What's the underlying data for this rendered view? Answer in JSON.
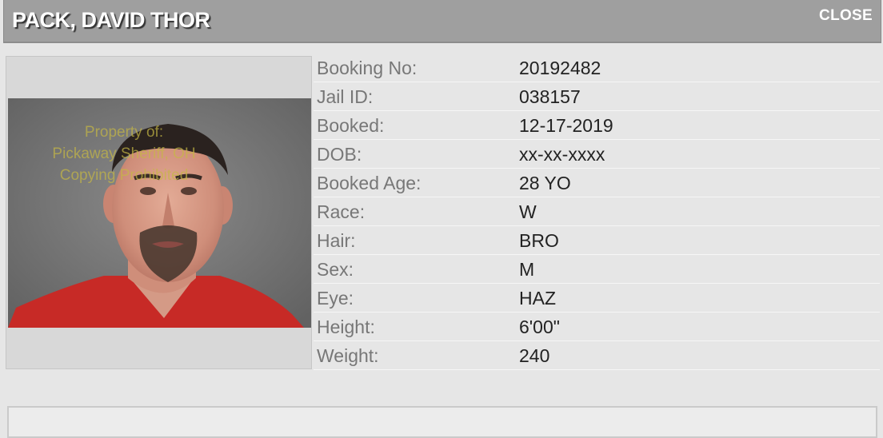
{
  "header": {
    "name": "PACK, DAVID THOR",
    "close_label": "CLOSE"
  },
  "photo": {
    "watermark_lines": [
      "Property of:",
      "Pickaway Sheriff, OH",
      "Copying Prohibited"
    ]
  },
  "details": {
    "rows": [
      {
        "label": "Booking No:",
        "value": "20192482"
      },
      {
        "label": "Jail ID:",
        "value": "038157"
      },
      {
        "label": "Booked:",
        "value": "12-17-2019"
      },
      {
        "label": "DOB:",
        "value": "xx-xx-xxxx"
      },
      {
        "label": "Booked Age:",
        "value": "28 YO"
      },
      {
        "label": "Race:",
        "value": "W"
      },
      {
        "label": "Hair:",
        "value": "BRO"
      },
      {
        "label": "Sex:",
        "value": "M"
      },
      {
        "label": "Eye:",
        "value": "HAZ"
      },
      {
        "label": "Height:",
        "value": "6'00\""
      },
      {
        "label": "Weight:",
        "value": "240"
      }
    ]
  },
  "colors": {
    "titlebar": "#9f9f9f",
    "background": "#e6e6e6",
    "label_text": "#777777",
    "value_text": "#222222",
    "watermark": "#c6b845",
    "shirt": "#c72a26"
  }
}
